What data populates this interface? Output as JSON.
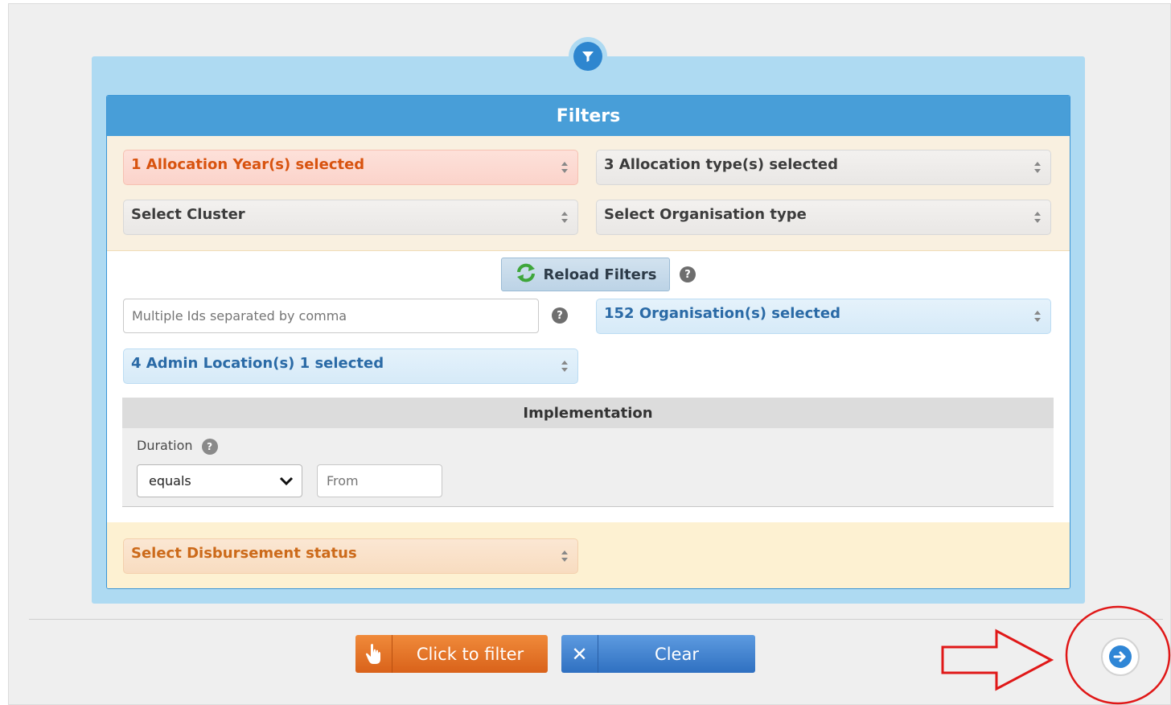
{
  "panel": {
    "title": "Filters"
  },
  "filters": {
    "allocation_year": "1 Allocation Year(s) selected",
    "allocation_type": "3 Allocation type(s) selected",
    "cluster": "Select Cluster",
    "organisation_type": "Select Organisation type",
    "reload_label": "Reload Filters",
    "ids_placeholder": "Multiple Ids separated by comma",
    "organisations": "152 Organisation(s) selected",
    "admin_location": "4 Admin Location(s) 1 selected",
    "disbursement_status": "Select Disbursement status"
  },
  "implementation": {
    "title": "Implementation",
    "duration_label": "Duration",
    "operator_value": "equals",
    "from_placeholder": "From"
  },
  "actions": {
    "filter_label": "Click to filter",
    "clear_label": "Clear"
  },
  "colors": {
    "header_blue": "#489ed8",
    "frame_blue": "#aedaf2",
    "filter_orange": "#e07428",
    "clear_blue": "#3f84d0",
    "annotation_red": "#e01818"
  },
  "icons": {
    "funnel": "filter-funnel-icon",
    "reload": "refresh-icon",
    "help": "question-circle-icon",
    "hand": "hand-pointer-icon",
    "clear": "close-icon",
    "next": "arrow-right-circle-icon"
  }
}
